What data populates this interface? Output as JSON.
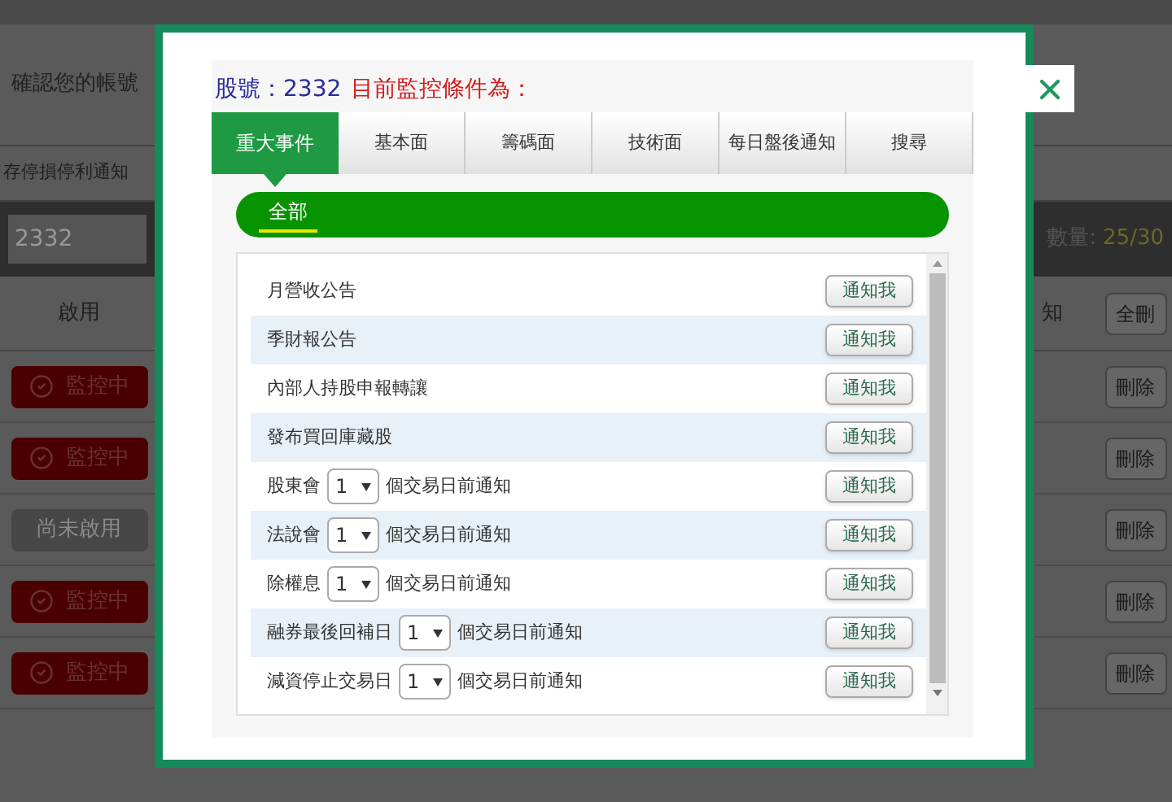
{
  "background": {
    "account_label": "確認您的帳號",
    "stop_loss_link": "存停損停利通知",
    "stock_input": {
      "value": "2332"
    },
    "quota_label": "數量:",
    "quota_value": "25/30",
    "columns": [
      "啟用",
      "知"
    ],
    "delete_all_button": "全刪",
    "rows": [
      {
        "status": "監控中",
        "active": true,
        "delete_button": "刪除"
      },
      {
        "status": "監控中",
        "active": true,
        "delete_button": "刪除"
      },
      {
        "status": "尚未啟用",
        "active": false,
        "delete_button": "刪除"
      },
      {
        "status": "監控中",
        "active": true,
        "delete_button": "刪除"
      },
      {
        "status": "監控中",
        "active": true,
        "delete_button": "刪除"
      }
    ]
  },
  "modal": {
    "stock_label": "股號：2332",
    "condition_label": "目前監控條件為：",
    "tabs": [
      {
        "label": "重大事件",
        "selected": true
      },
      {
        "label": "基本面",
        "selected": false
      },
      {
        "label": "籌碼面",
        "selected": false
      },
      {
        "label": "技術面",
        "selected": false
      },
      {
        "label": "每日盤後通知",
        "selected": false
      },
      {
        "label": "搜尋",
        "selected": false
      }
    ],
    "subtabs": [
      {
        "label": "全部",
        "selected": true
      }
    ],
    "items": [
      {
        "kind": "plain",
        "label": "月營收公告",
        "button": "通知我"
      },
      {
        "kind": "plain",
        "label": "季財報公告",
        "button": "通知我"
      },
      {
        "kind": "plain",
        "label": "內部人持股申報轉讓",
        "button": "通知我"
      },
      {
        "kind": "plain",
        "label": "發布買回庫藏股",
        "button": "通知我"
      },
      {
        "kind": "select",
        "label": "股東會",
        "select_value": "1",
        "suffix": "個交易日前通知",
        "button": "通知我"
      },
      {
        "kind": "select",
        "label": "法說會",
        "select_value": "1",
        "suffix": "個交易日前通知",
        "button": "通知我"
      },
      {
        "kind": "select",
        "label": "除權息",
        "select_value": "1",
        "suffix": "個交易日前通知",
        "button": "通知我"
      },
      {
        "kind": "select",
        "label": "融券最後回補日",
        "select_value": "1",
        "suffix": "個交易日前通知",
        "button": "通知我"
      },
      {
        "kind": "select",
        "label": "減資停止交易日",
        "select_value": "1",
        "suffix": "個交易日前通知",
        "button": "通知我"
      }
    ]
  }
}
